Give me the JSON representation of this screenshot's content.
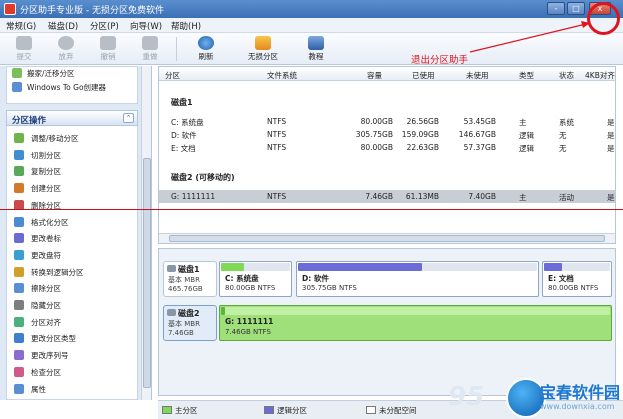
{
  "window": {
    "title": "分区助手专业版 - 无损分区免费软件",
    "controls": [
      "-",
      "□",
      "x"
    ]
  },
  "menu": {
    "items": [
      "常规(G)",
      "磁盘(D)",
      "分区(P)",
      "向导(W)",
      "帮助(H)"
    ]
  },
  "toolbar": {
    "buttons": [
      {
        "label": "提交",
        "icon": "check-icon",
        "enabled": false
      },
      {
        "label": "放弃",
        "icon": "discard-icon",
        "enabled": false
      },
      {
        "label": "撤销",
        "icon": "undo-icon",
        "enabled": false
      },
      {
        "label": "重做",
        "icon": "redo-icon",
        "enabled": false
      },
      {
        "label": "刷新",
        "icon": "refresh-icon",
        "enabled": true
      },
      {
        "label": "无损分区",
        "icon": "house-icon",
        "enabled": true
      },
      {
        "label": "教程",
        "icon": "book-icon",
        "enabled": true
      }
    ]
  },
  "sidebar": {
    "top_items": [
      "搬家/迁移分区",
      "Windows To Go创建器"
    ],
    "section_title": "分区操作",
    "operations": [
      "调整/移动分区",
      "切割分区",
      "复制分区",
      "创建分区",
      "删除分区",
      "格式化分区",
      "更改卷标",
      "更改盘符",
      "转换到逻辑分区",
      "擦除分区",
      "隐藏分区",
      "分区对齐",
      "更改分区类型",
      "更改序列号",
      "检查分区",
      "属性"
    ]
  },
  "grid": {
    "headers": [
      "分区",
      "文件系统",
      "容量",
      "已使用",
      "未使用",
      "类型",
      "状态",
      "4KB对齐"
    ],
    "disks": [
      {
        "title": "磁盘1",
        "rows": [
          {
            "partition": "C: 系统盘",
            "fs": "NTFS",
            "capacity": "80.00GB",
            "used": "26.56GB",
            "free": "53.45GB",
            "type": "主",
            "status": "系统",
            "align": "是"
          },
          {
            "partition": "D: 软件",
            "fs": "NTFS",
            "capacity": "305.75GB",
            "used": "159.09GB",
            "free": "146.67GB",
            "type": "逻辑",
            "status": "无",
            "align": "是"
          },
          {
            "partition": "E: 文档",
            "fs": "NTFS",
            "capacity": "80.00GB",
            "used": "22.63GB",
            "free": "57.37GB",
            "type": "逻辑",
            "status": "无",
            "align": "是"
          }
        ]
      },
      {
        "title": "磁盘2 (可移动的)",
        "rows": [
          {
            "partition": "G: 1111111",
            "fs": "NTFS",
            "capacity": "7.46GB",
            "used": "61.13MB",
            "free": "7.40GB",
            "type": "主",
            "status": "活动",
            "align": "是"
          }
        ]
      }
    ]
  },
  "disk_map": {
    "disks": [
      {
        "name": "磁盘1",
        "type": "基本 MBR",
        "size": "465.76GB",
        "partitions": [
          {
            "name": "C: 系统盘",
            "info": "80.00GB NTFS",
            "used_fraction": 0.33
          },
          {
            "name": "D: 软件",
            "info": "305.75GB NTFS",
            "used_fraction": 0.52
          },
          {
            "name": "E: 文档",
            "info": "80.00GB NTFS",
            "used_fraction": 0.28
          }
        ]
      },
      {
        "name": "磁盘2",
        "type": "基本 MBR",
        "size": "7.46GB",
        "partitions": [
          {
            "name": "G: 1111111",
            "info": "7.46GB NTFS",
            "used_fraction": 0.01
          }
        ]
      }
    ]
  },
  "legend": [
    {
      "label": "主分区",
      "color": "#7ed957"
    },
    {
      "label": "逻辑分区",
      "color": "#6c6cd8"
    },
    {
      "label": "未分配空间",
      "color": "#ffffff"
    }
  ],
  "annotation": {
    "text": "退出分区助手",
    "color": "#e0141e"
  },
  "watermark": {
    "number": "95",
    "brand": "宝春软件园",
    "url": "www.downxia.com"
  }
}
